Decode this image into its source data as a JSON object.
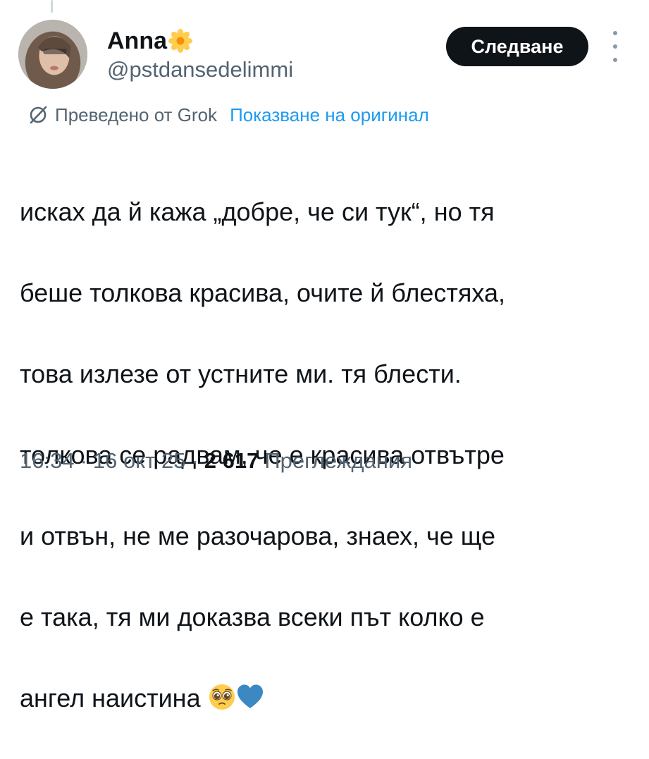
{
  "author": {
    "display_name": "Anna",
    "handle": "@pstdansedelimmi",
    "name_emoji": "blossom-icon"
  },
  "follow_button": {
    "label": "Следване"
  },
  "more_menu": {
    "icon": "more-vertical-icon"
  },
  "translation": {
    "icon": "grok-icon",
    "label": "Преведено от Grok",
    "show_original": "Показване на оригинал"
  },
  "tweet": {
    "text_lines": [
      "исках да й кажа „добре, че си тук“, но тя",
      "беше толкова красива, очите й блестяха,",
      "това излезе от устните ми. тя блести.",
      "толкова се радвам, че е красива отвътре",
      "и отвън, не ме разочарова, знаех, че ще",
      "е така, тя ми доказва всеки път колко е",
      "ангел наистина"
    ],
    "emojis": [
      "pleading-face-icon",
      "blue-heart-icon"
    ]
  },
  "meta": {
    "time": "16:34",
    "separator": "·",
    "date": "16 окт 25",
    "views_count": "2 617",
    "views_label": "Преглеждания"
  },
  "colors": {
    "text": "#0f1419",
    "secondary": "#536471",
    "link": "#1d9bf0",
    "button_bg": "#0f1419"
  }
}
